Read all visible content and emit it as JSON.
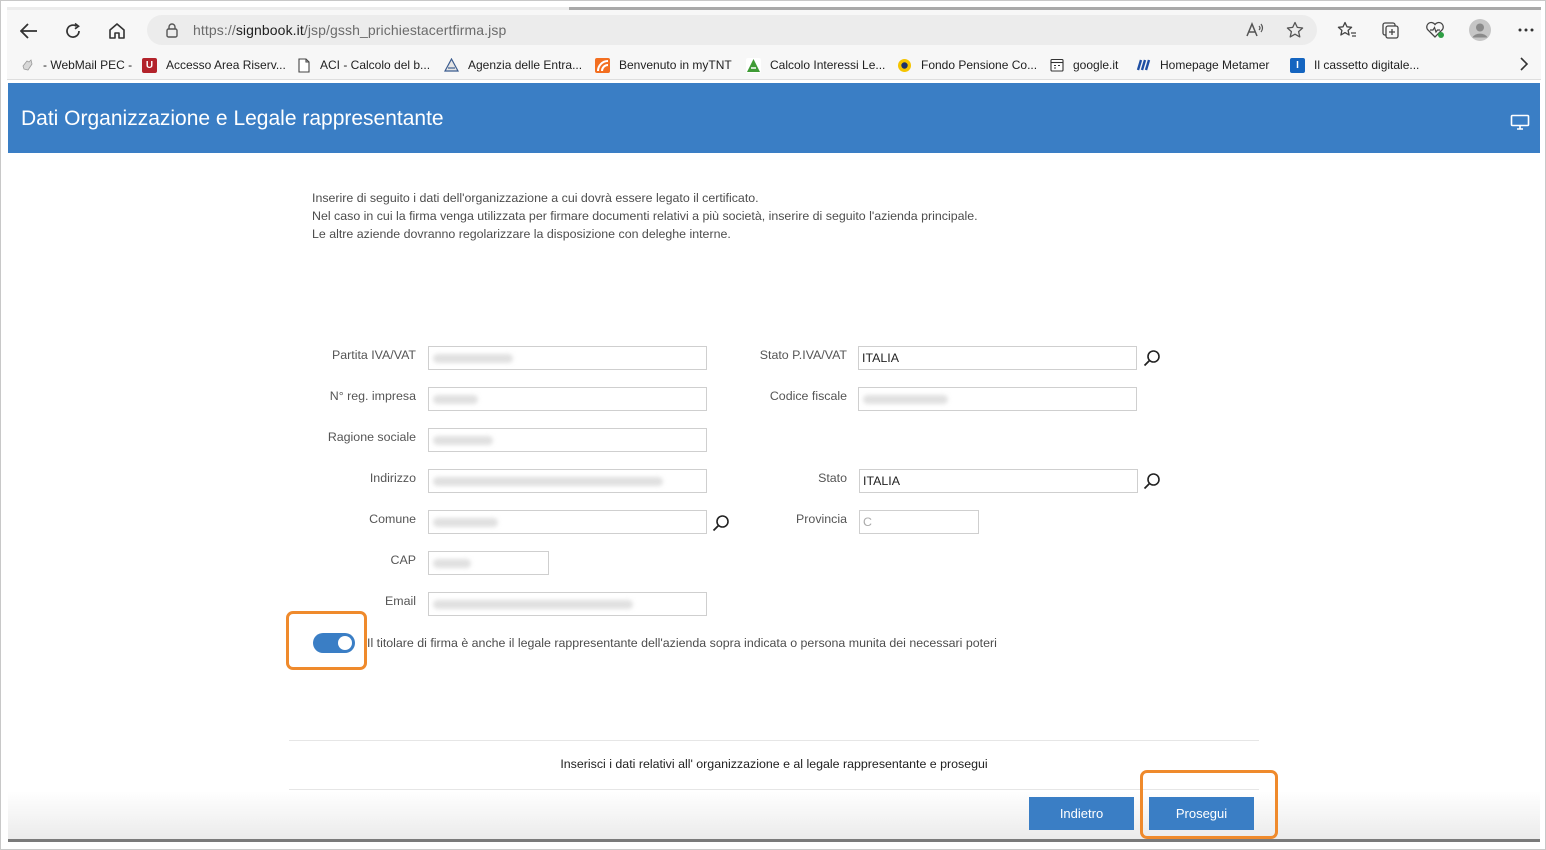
{
  "browser": {
    "url_prefix": "https://",
    "url_host": "signbook.it",
    "url_path": "/jsp/gssh_prichiestacertfirma.jsp",
    "bookmarks": [
      {
        "label": "- WebMail PEC -",
        "icon": "hand-icon",
        "color": "#b0b0b0"
      },
      {
        "label": "Accesso Area Riserv...",
        "icon": "u-logo-icon",
        "color": "#b3232b"
      },
      {
        "label": "ACI - Calcolo del b...",
        "icon": "document-icon",
        "color": "#ffffff"
      },
      {
        "label": "Agenzia delle Entra...",
        "icon": "agenzia-icon",
        "color": "#3b5c8f"
      },
      {
        "label": "Benvenuto in myTNT",
        "icon": "tnt-icon",
        "color": "#f36f21"
      },
      {
        "label": "Calcolo Interessi Le...",
        "icon": "a-logo-icon",
        "color": "#3f9b35"
      },
      {
        "label": "Fondo Pensione Co...",
        "icon": "fondo-icon",
        "color": "#f5c400"
      },
      {
        "label": "google.it",
        "icon": "calendar-icon",
        "color": "#ffffff"
      },
      {
        "label": "Homepage  Metamer",
        "icon": "metamer-icon",
        "color": "#1f4fa3"
      },
      {
        "label": "Il cassetto digitale...",
        "icon": "cassetto-icon",
        "color": "#1565c0"
      }
    ]
  },
  "header": {
    "title": "Dati Organizzazione e Legale rappresentante"
  },
  "intro": {
    "line1": "Inserire di seguito i dati dell'organizzazione a cui dovrà essere legato il certificato.",
    "line2": "Nel caso in cui la firma venga utilizzata per firmare documenti relativi a più società, inserire di seguito l'azienda principale.",
    "line3": "Le altre aziende dovranno regolarizzare la disposizione con deleghe interne."
  },
  "form": {
    "partita_iva_label": "Partita IVA/VAT",
    "stato_piva_label": "Stato P.IVA/VAT",
    "stato_piva_value": "ITALIA",
    "nreg_label": "N° reg. impresa",
    "codice_fiscale_label": "Codice fiscale",
    "ragione_sociale_label": "Ragione sociale",
    "indirizzo_label": "Indirizzo",
    "stato_label": "Stato",
    "stato_value": "ITALIA",
    "comune_label": "Comune",
    "provincia_label": "Provincia",
    "provincia_value": "C",
    "cap_label": "CAP",
    "email_label": "Email"
  },
  "toggle": {
    "on": true,
    "label": "Il titolare di firma è anche il legale rappresentante dell'azienda sopra indicata o persona munita dei necessari poteri"
  },
  "footer": {
    "message": "Inserisci i dati relativi all' organizzazione e al legale rappresentante e prosegui",
    "back_label": "Indietro",
    "next_label": "Prosegui"
  },
  "colors": {
    "header": "#3a7ec5",
    "button": "#3a7ec5",
    "highlight": "#ef8a2c"
  }
}
